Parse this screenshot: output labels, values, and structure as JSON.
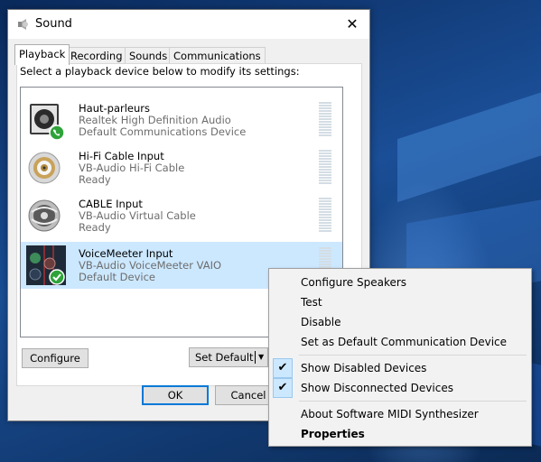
{
  "window": {
    "title": "Sound",
    "close_glyph": "✕"
  },
  "tabs": [
    {
      "label": "Playback",
      "active": true
    },
    {
      "label": "Recording",
      "active": false
    },
    {
      "label": "Sounds",
      "active": false
    },
    {
      "label": "Communications",
      "active": false
    }
  ],
  "instruction": "Select a playback device below to modify its settings:",
  "devices": [
    {
      "name": "Haut-parleurs",
      "driver": "Realtek High Definition Audio",
      "status": "Default Communications Device",
      "icon": "speaker-icon",
      "badge": "phone-badge-icon",
      "selected": false
    },
    {
      "name": "Hi-Fi Cable Input",
      "driver": "VB-Audio Hi-Fi Cable",
      "status": "Ready",
      "icon": "rca-jack-icon",
      "selected": false
    },
    {
      "name": "CABLE Input",
      "driver": "VB-Audio Virtual Cable",
      "status": "Ready",
      "icon": "cable-icon",
      "selected": false
    },
    {
      "name": "VoiceMeeter Input",
      "driver": "VB-Audio VoiceMeeter VAIO",
      "status": "Default Device",
      "icon": "voicemeeter-icon",
      "badge": "checkmark-badge-icon",
      "selected": true
    }
  ],
  "buttons": {
    "configure": "Configure",
    "set_default": "Set Default",
    "set_default_arrow": "▼",
    "ok": "OK",
    "cancel": "Cancel"
  },
  "context_menu": {
    "items": [
      {
        "label": "Configure Speakers",
        "checked": false,
        "bold": false
      },
      {
        "label": "Test",
        "checked": false,
        "bold": false
      },
      {
        "label": "Disable",
        "checked": false,
        "bold": false
      },
      {
        "label": "Set as Default Communication Device",
        "checked": false,
        "bold": false
      },
      {
        "label": "Show Disabled Devices",
        "checked": true,
        "bold": false
      },
      {
        "label": "Show Disconnected Devices",
        "checked": true,
        "bold": false
      },
      {
        "label": "About Software MIDI Synthesizer",
        "checked": false,
        "bold": false
      },
      {
        "label": "Properties",
        "checked": false,
        "bold": true
      }
    ],
    "check_glyph": "✔"
  },
  "colors": {
    "selection": "#cce8ff",
    "accent": "#0078d7",
    "badge_green": "#2fa33a"
  }
}
